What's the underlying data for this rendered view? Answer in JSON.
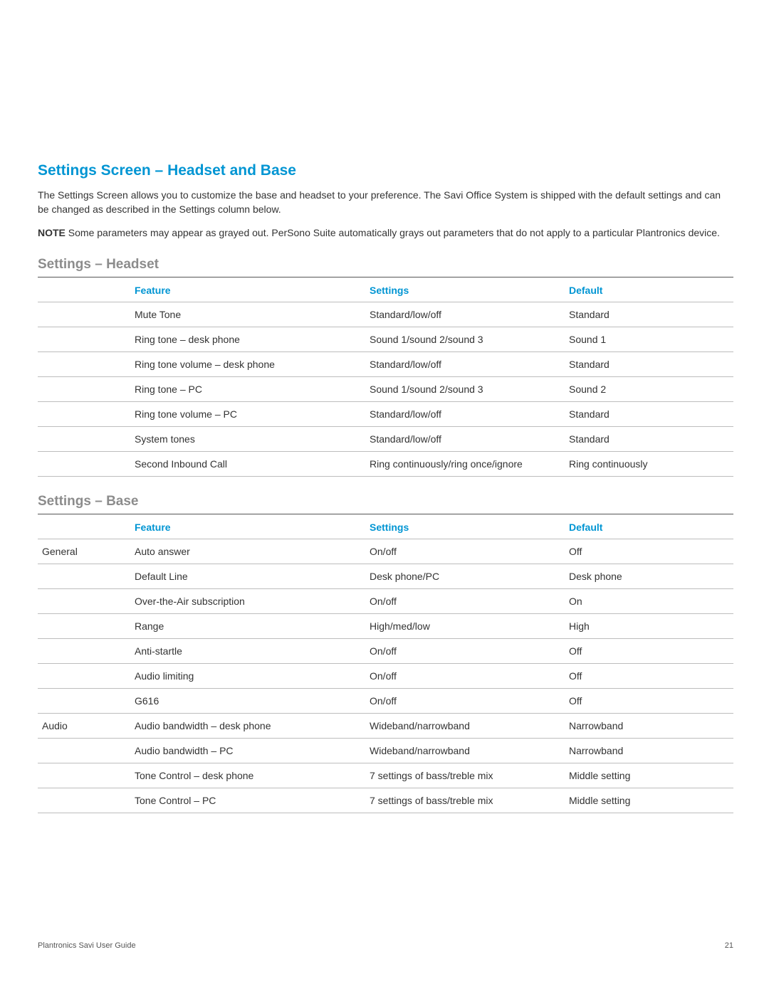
{
  "title": "Settings Screen – Headset and Base",
  "intro1": "The Settings Screen allows you to customize the base and headset to your preference. The Savi Office System is shipped with the default settings and can be changed as described in the Settings column below.",
  "note_label": "NOTE",
  "note_text": " Some parameters may appear as grayed out.  PerSono Suite automatically grays out parameters that do not apply to a particular Plantronics device.",
  "headset": {
    "heading": "Settings – Headset",
    "cols": {
      "feature": "Feature",
      "settings": "Settings",
      "default": "Default"
    },
    "rows": [
      {
        "feature": "Mute Tone",
        "settings": "Standard/low/off",
        "default": "Standard"
      },
      {
        "feature": "Ring tone – desk phone",
        "settings": "Sound 1/sound 2/sound 3",
        "default": "Sound 1"
      },
      {
        "feature": "Ring tone volume – desk phone",
        "settings": "Standard/low/off",
        "default": "Standard"
      },
      {
        "feature": "Ring tone – PC",
        "settings": "Sound 1/sound 2/sound 3",
        "default": "Sound 2"
      },
      {
        "feature": "Ring tone volume – PC",
        "settings": "Standard/low/off",
        "default": "Standard"
      },
      {
        "feature": "System tones",
        "settings": "Standard/low/off",
        "default": "Standard"
      },
      {
        "feature": "Second Inbound Call",
        "settings": "Ring continuously/ring once/ignore",
        "default": "Ring continuously"
      }
    ]
  },
  "base": {
    "heading": "Settings – Base",
    "cols": {
      "feature": "Feature",
      "settings": "Settings",
      "default": "Default"
    },
    "rows": [
      {
        "category": "General",
        "feature": "Auto answer",
        "settings": "On/off",
        "default": "Off"
      },
      {
        "category": "",
        "feature": "Default Line",
        "settings": "Desk phone/PC",
        "default": "Desk phone"
      },
      {
        "category": "",
        "feature": "Over-the-Air subscription",
        "settings": "On/off",
        "default": "On"
      },
      {
        "category": "",
        "feature": "Range",
        "settings": "High/med/low",
        "default": "High"
      },
      {
        "category": "",
        "feature": "Anti-startle",
        "settings": "On/off",
        "default": "Off"
      },
      {
        "category": "",
        "feature": "Audio limiting",
        "settings": "On/off",
        "default": "Off"
      },
      {
        "category": "",
        "feature": "G616",
        "settings": "On/off",
        "default": "Off"
      },
      {
        "category": "Audio",
        "feature": "Audio bandwidth – desk phone",
        "settings": "Wideband/narrowband",
        "default": "Narrowband"
      },
      {
        "category": "",
        "feature": "Audio bandwidth – PC",
        "settings": "Wideband/narrowband",
        "default": "Narrowband"
      },
      {
        "category": "",
        "feature": "Tone Control – desk phone",
        "settings": "7 settings of bass/treble mix",
        "default": "Middle setting"
      },
      {
        "category": "",
        "feature": "Tone Control – PC",
        "settings": "7 settings of bass/treble mix",
        "default": "Middle setting"
      }
    ]
  },
  "footer": {
    "left": "Plantronics Savi User Guide",
    "right": "21"
  }
}
